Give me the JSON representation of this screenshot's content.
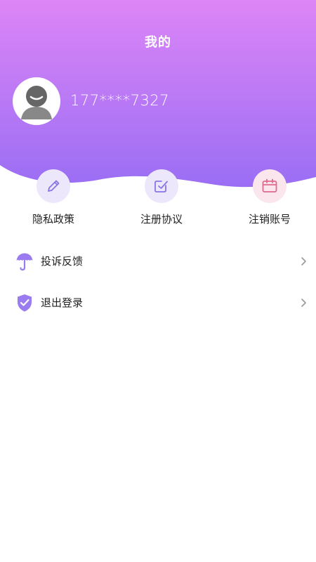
{
  "header": {
    "title": "我的",
    "phone": "177****7327",
    "gradient_top": "#dd85f6",
    "gradient_bottom": "#9a6ef4"
  },
  "quick_actions": [
    {
      "label": "隐私政策",
      "icon": "pencil-icon",
      "bg": "#ece7fb",
      "color": "#8a74e8"
    },
    {
      "label": "注册协议",
      "icon": "checkbox-icon",
      "bg": "#ece7fb",
      "color": "#8a74e8"
    },
    {
      "label": "注销账号",
      "icon": "calendar-icon",
      "bg": "#fbe6ee",
      "color": "#e06a8e"
    }
  ],
  "menu": [
    {
      "label": "投诉反馈",
      "icon": "umbrella-icon"
    },
    {
      "label": "退出登录",
      "icon": "shield-check-icon"
    }
  ],
  "colors": {
    "accent": "#9a7cf0",
    "chevron": "#999999"
  }
}
